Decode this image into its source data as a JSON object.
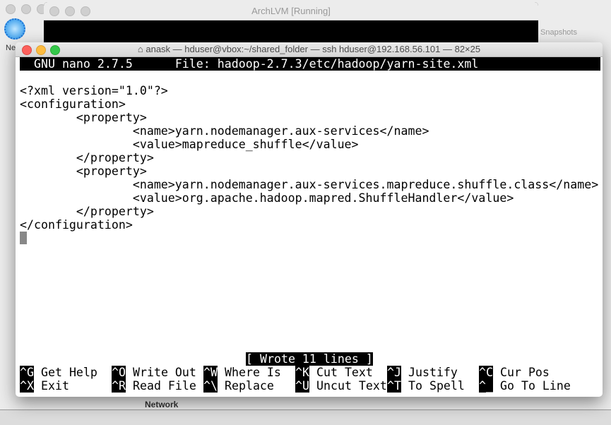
{
  "background": {
    "vm_title": "ArchLVM [Running]",
    "snapshots_label": "Snapshots",
    "network_label": "Network",
    "new_label": "Ne"
  },
  "terminal": {
    "title": "anask — hduser@vbox:~/shared_folder — ssh hduser@192.168.56.101 — 82×25",
    "nano_version": "GNU nano 2.7.5",
    "file_label": "File: hadoop-2.7.3/etc/hadoop/yarn-site.xml",
    "lines": [
      "<?xml version=\"1.0\"?>",
      "<configuration>",
      "        <property>",
      "                <name>yarn.nodemanager.aux-services</name>",
      "                <value>mapreduce_shuffle</value>",
      "        </property>",
      "        <property>",
      "                <name>yarn.nodemanager.aux-services.mapreduce.shuffle.class</name>",
      "                <value>org.apache.hadoop.mapred.ShuffleHandler</value>",
      "        </property>",
      "</configuration>"
    ],
    "status": "[ Wrote 11 lines ]",
    "shortcuts_row1": [
      {
        "key": "^G",
        "label": "Get Help"
      },
      {
        "key": "^O",
        "label": "Write Out"
      },
      {
        "key": "^W",
        "label": "Where Is"
      },
      {
        "key": "^K",
        "label": "Cut Text"
      },
      {
        "key": "^J",
        "label": "Justify"
      },
      {
        "key": "^C",
        "label": "Cur Pos"
      }
    ],
    "shortcuts_row2": [
      {
        "key": "^X",
        "label": "Exit"
      },
      {
        "key": "^R",
        "label": "Read File"
      },
      {
        "key": "^\\",
        "label": "Replace"
      },
      {
        "key": "^U",
        "label": "Uncut Text"
      },
      {
        "key": "^T",
        "label": "To Spell"
      },
      {
        "key": "^_",
        "label": "Go To Line"
      }
    ]
  }
}
